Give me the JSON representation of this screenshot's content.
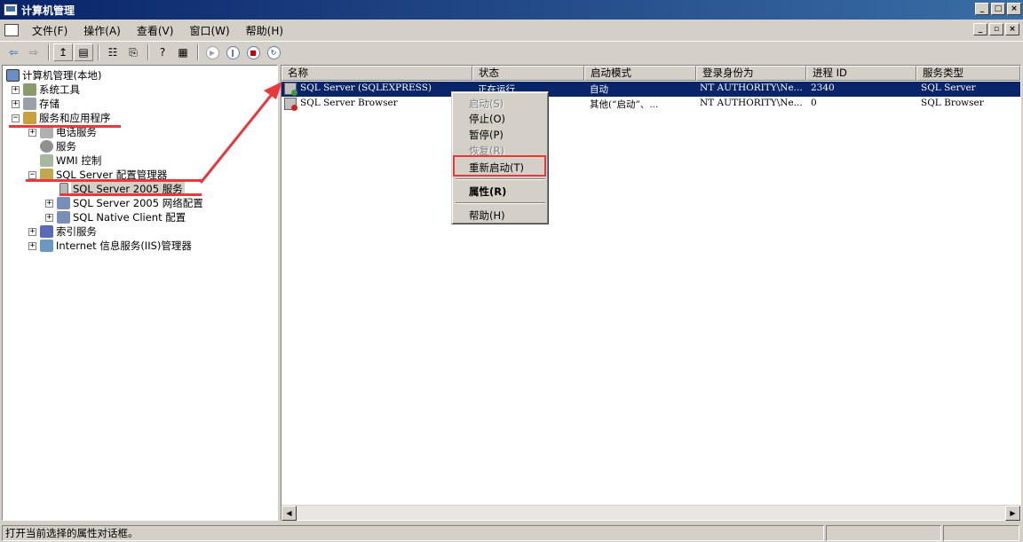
{
  "window": {
    "title": "计算机管理"
  },
  "menu": [
    "文件(F)",
    "操作(A)",
    "查看(V)",
    "窗口(W)",
    "帮助(H)"
  ],
  "window_buttons": [
    "_",
    "□",
    "×"
  ],
  "mdi_buttons": [
    "_",
    "▫",
    "×"
  ],
  "toolbar": [
    {
      "name": "back",
      "glyph": "⇦",
      "enabled": true
    },
    {
      "name": "forward",
      "glyph": "⇨",
      "enabled": false
    },
    {
      "name": "up",
      "glyph": "↥",
      "enabled": true
    },
    {
      "name": "show-hide-tree",
      "glyph": "▤",
      "enabled": true
    },
    {
      "name": "properties",
      "glyph": "☷",
      "enabled": true
    },
    {
      "name": "export",
      "glyph": "⎘",
      "enabled": true
    },
    {
      "name": "help",
      "glyph": "?",
      "enabled": true
    },
    {
      "name": "mmc",
      "glyph": "▦",
      "enabled": true
    },
    {
      "name": "start",
      "glyph": "▶",
      "enabled": false
    },
    {
      "name": "pause",
      "glyph": "‖",
      "enabled": true
    },
    {
      "name": "stop",
      "glyph": "■",
      "enabled": true
    },
    {
      "name": "restart",
      "glyph": "↻",
      "enabled": true
    }
  ],
  "tree": {
    "root": "计算机管理(本地)",
    "items": [
      {
        "label": "系统工具",
        "indent": 1,
        "expander": "+"
      },
      {
        "label": "存储",
        "indent": 1,
        "expander": "+"
      },
      {
        "label": "服务和应用程序",
        "indent": 1,
        "expander": "−"
      },
      {
        "label": "电话服务",
        "indent": 2,
        "expander": "+"
      },
      {
        "label": "服务",
        "indent": 2,
        "expander": ""
      },
      {
        "label": "WMI 控制",
        "indent": 2,
        "expander": ""
      },
      {
        "label": "SQL Server 配置管理器",
        "indent": 2,
        "expander": "−"
      },
      {
        "label": "SQL Server 2005 服务",
        "indent": 3,
        "expander": ""
      },
      {
        "label": "SQL Server 2005 网络配置",
        "indent": 3,
        "expander": "+"
      },
      {
        "label": "SQL Native Client 配置",
        "indent": 3,
        "expander": "+"
      },
      {
        "label": "索引服务",
        "indent": 2,
        "expander": "+"
      },
      {
        "label": "Internet 信息服务(IIS)管理器",
        "indent": 2,
        "expander": "+"
      }
    ]
  },
  "list": {
    "columns": [
      "名称",
      "状态",
      "启动模式",
      "登录身份为",
      "进程 ID",
      "服务类型"
    ],
    "rows": [
      {
        "name": "SQL Server (SQLEXPRESS)",
        "status": "正在运行",
        "start_mode": "自动",
        "logon": "NT AUTHORITY\\Ne...",
        "pid": "2340",
        "type": "SQL Server",
        "selected": true,
        "state_color": "#3c9c3c"
      },
      {
        "name": "SQL Server Browser",
        "status": "",
        "start_mode": "其他(“启动”、...",
        "logon": "NT AUTHORITY\\Ne...",
        "pid": "0",
        "type": "SQL Browser",
        "selected": false,
        "state_color": "#d02020"
      }
    ]
  },
  "context_menu": {
    "items": [
      {
        "label": "启动(S)",
        "disabled": true
      },
      {
        "label": "停止(O)",
        "disabled": false
      },
      {
        "label": "暂停(P)",
        "disabled": false
      },
      {
        "label": "恢复(R)",
        "disabled": true
      },
      {
        "label": "重新启动(T)",
        "disabled": false,
        "highlighted": true
      },
      {
        "label": "属性(R)",
        "disabled": false,
        "bold": true
      },
      {
        "label": "帮助(H)",
        "disabled": false
      }
    ]
  },
  "status_bar": {
    "text": "打开当前选择的属性对话框。"
  },
  "colors": {
    "title_gradient_start": "#0a246a",
    "title_gradient_end": "#3a6ea5",
    "selection": "#0a246a",
    "annotation": "#e8383c"
  }
}
